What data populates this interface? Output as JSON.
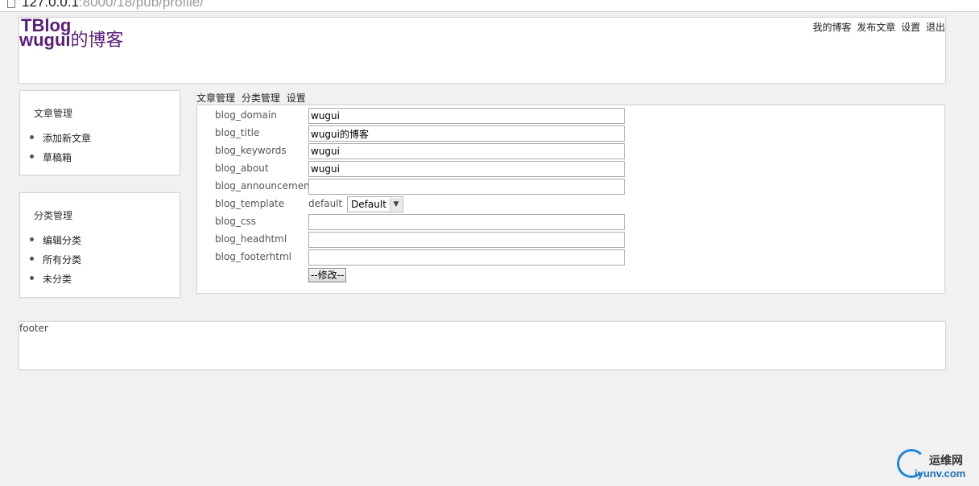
{
  "browser": {
    "url_host": "127.0.0.1",
    "url_rest": ":8000/18/pub/profile/"
  },
  "header": {
    "site_name": "TBlog",
    "blog_title_domain": "wugui",
    "blog_title_suffix": "的博客",
    "nav": [
      {
        "label": "我的博客"
      },
      {
        "label": "发布文章"
      },
      {
        "label": "设置"
      },
      {
        "label": "退出"
      }
    ]
  },
  "sidebar": {
    "articles": {
      "title": "文章管理",
      "items": [
        {
          "label": "添加新文章"
        },
        {
          "label": "草稿箱"
        }
      ]
    },
    "categories": {
      "title": "分类管理",
      "items": [
        {
          "label": "编辑分类"
        },
        {
          "label": "所有分类"
        },
        {
          "label": "未分类"
        }
      ]
    }
  },
  "sub_nav": [
    {
      "label": "文章管理"
    },
    {
      "label": "分类管理"
    },
    {
      "label": "设置"
    }
  ],
  "form": {
    "fields": [
      {
        "label": "blog_domain",
        "value": "wugui"
      },
      {
        "label": "blog_title",
        "value": "wugui的博客"
      },
      {
        "label": "blog_keywords",
        "value": "wugui"
      },
      {
        "label": "blog_about",
        "value": "wugui"
      },
      {
        "label": "blog_announcement",
        "value": ""
      },
      {
        "label": "blog_template",
        "current": "default",
        "selected": "Default"
      },
      {
        "label": "blog_css",
        "value": ""
      },
      {
        "label": "blog_headhtml",
        "value": ""
      },
      {
        "label": "blog_footerhtml",
        "value": ""
      }
    ],
    "submit_label": "--修改--"
  },
  "footer": {
    "text": "footer"
  },
  "watermark": {
    "cn": "运维网",
    "en": "iyunv.com"
  },
  "colors": {
    "brand": "#5a1e7a",
    "page_bg": "#f1f1f1",
    "box_bg": "#ffffff"
  }
}
